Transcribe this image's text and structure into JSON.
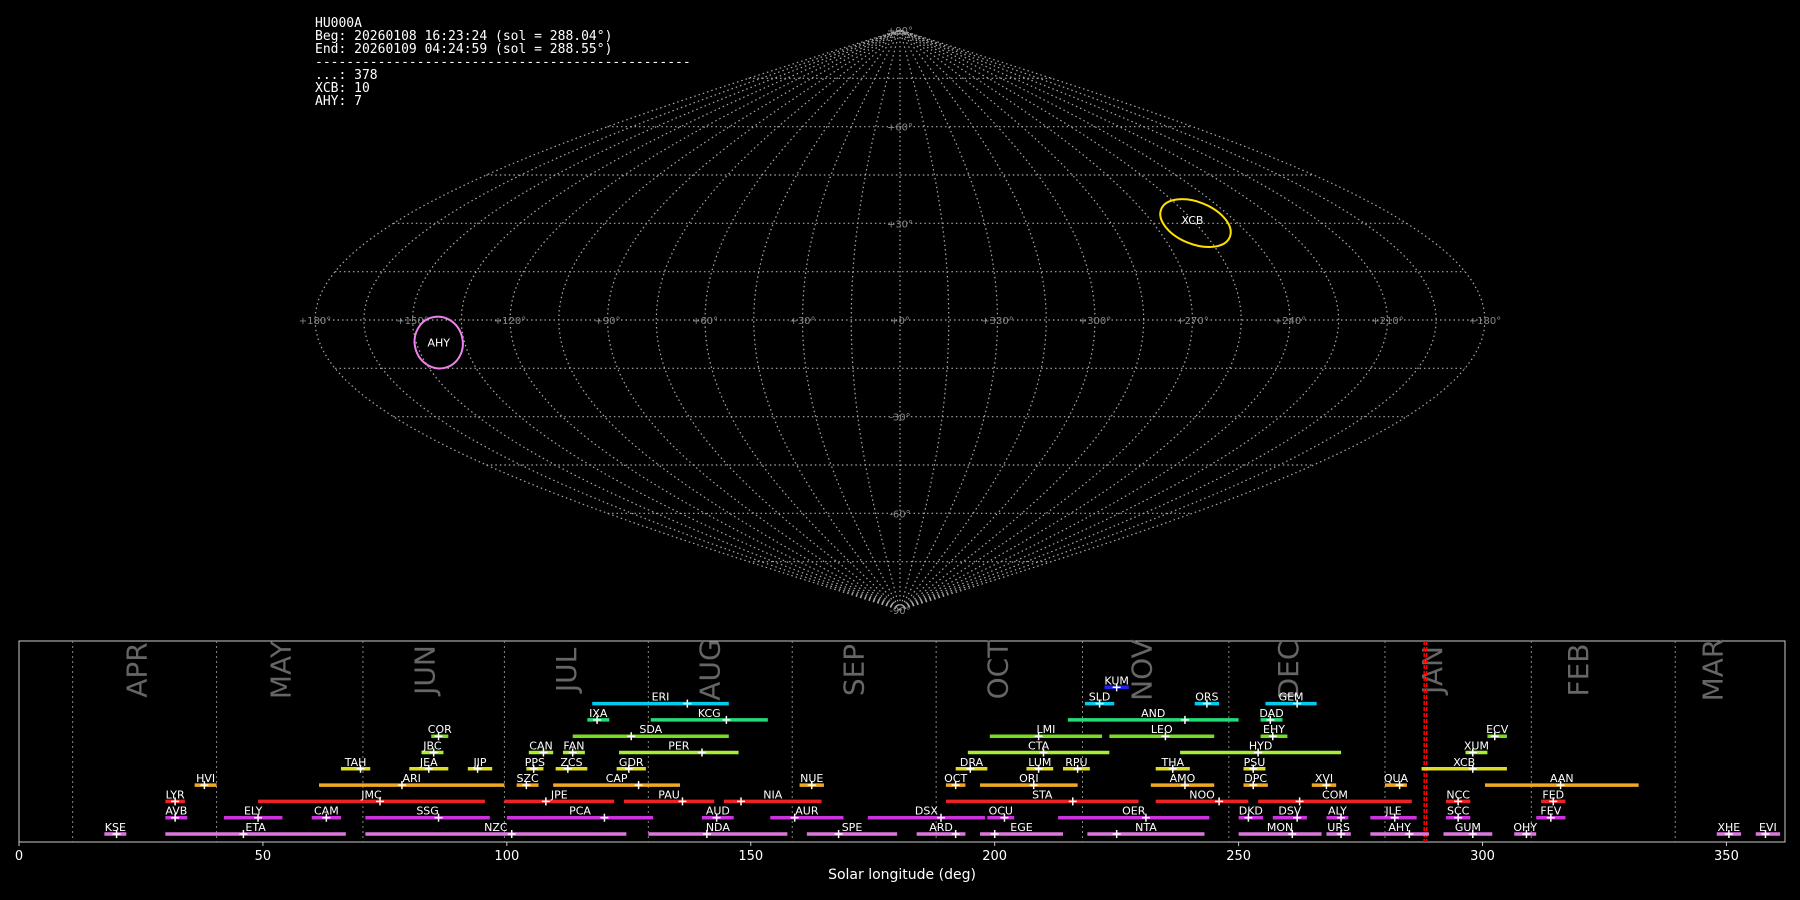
{
  "info": {
    "station": "HU000A",
    "beg": "Beg: 20260108 16:23:24 (sol = 288.04°)",
    "end": "End: 20260109 04:24:59 (sol = 288.55°)",
    "separator": "------------------------------------------------",
    "counts": [
      "...: 378",
      "XCB: 10",
      "AHY: 7"
    ]
  },
  "colors": {
    "background": "#000000",
    "grid": "#aaaaaa",
    "xcb_ellipse": "#ffe000",
    "ahy_ellipse": "#ee82ee",
    "current_sol_marker": "#ff0000"
  },
  "chart_data": [
    {
      "type": "scatter",
      "projection": "sinusoidal",
      "lon_ticks": [
        "+180°",
        "+150°",
        "+120°",
        "+90°",
        "+60°",
        "+30°",
        "+0°",
        "+330°",
        "+300°",
        "+270°",
        "+240°",
        "+210°",
        "+180°"
      ],
      "lat_ticks": [
        "+90°",
        "+60°",
        "+30°",
        "-30°",
        "-60°",
        "-90°"
      ],
      "lon_tick_values": [
        180,
        150,
        120,
        90,
        60,
        30,
        0,
        330,
        300,
        270,
        240,
        210,
        180
      ],
      "lat_tick_values": [
        90,
        60,
        30,
        -30,
        -60,
        -90
      ],
      "radiant_labels": [
        {
          "name": "XCB",
          "lon": 255,
          "lat": 31
        },
        {
          "name": "AHY",
          "lon": 143,
          "lat": -7
        }
      ],
      "grid": true
    },
    {
      "type": "bar",
      "xlabel": "Solar longitude (deg)",
      "xlim": [
        0,
        362
      ],
      "x_ticks": [
        0,
        50,
        100,
        150,
        200,
        250,
        300,
        350
      ],
      "month_labels": [
        "APR",
        "MAY",
        "JUN",
        "JUL",
        "AUG",
        "SEP",
        "OCT",
        "NOV",
        "DEC",
        "JAN",
        "FEB",
        "MAR"
      ],
      "month_label_positions": [
        24.5,
        54,
        83.5,
        112.5,
        142,
        171.5,
        201,
        230.5,
        260.5,
        290,
        320,
        347.5
      ],
      "month_boundaries": [
        11,
        40.5,
        70.5,
        99.5,
        129,
        158.5,
        188,
        218,
        248,
        280,
        310,
        339.5
      ],
      "current_sol": [
        288.04,
        288.55
      ],
      "showers": [
        {
          "name": "KUM",
          "start": 222.5,
          "end": 227.5,
          "peak": 225,
          "color": "#2222ee",
          "row": 10
        },
        {
          "name": "ERI",
          "start": 117.5,
          "end": 145.5,
          "peak": 137,
          "color": "#00ccee",
          "row": 9
        },
        {
          "name": "SLD",
          "start": 218.5,
          "end": 224.5,
          "peak": 221.5,
          "color": "#00ccee",
          "row": 9
        },
        {
          "name": "ORS",
          "start": 241,
          "end": 246,
          "peak": 243.5,
          "color": "#00ccee",
          "row": 9
        },
        {
          "name": "GEM",
          "start": 255.5,
          "end": 266,
          "peak": 262,
          "color": "#00ccee",
          "row": 9
        },
        {
          "name": "IXA",
          "start": 116.5,
          "end": 121,
          "peak": 118.5,
          "color": "#22dd77",
          "row": 8
        },
        {
          "name": "KCG",
          "start": 129.5,
          "end": 153.5,
          "peak": 145,
          "color": "#22dd77",
          "row": 8
        },
        {
          "name": "AND",
          "start": 215,
          "end": 250,
          "peak": 239,
          "color": "#22dd77",
          "row": 8
        },
        {
          "name": "DAD",
          "start": 254.5,
          "end": 259,
          "peak": 256.5,
          "color": "#22dd77",
          "row": 8
        },
        {
          "name": "COR",
          "start": 84.5,
          "end": 88,
          "peak": 86,
          "color": "#77dd22",
          "row": 7
        },
        {
          "name": "SDA",
          "start": 113.5,
          "end": 145.5,
          "peak": 125.5,
          "color": "#77dd22",
          "row": 7
        },
        {
          "name": "LMI",
          "start": 199,
          "end": 222,
          "peak": 209,
          "color": "#77dd22",
          "row": 7
        },
        {
          "name": "LEO",
          "start": 223.5,
          "end": 245,
          "peak": 235,
          "color": "#77dd22",
          "row": 7
        },
        {
          "name": "EHY",
          "start": 254.5,
          "end": 260,
          "peak": 257,
          "color": "#77dd22",
          "row": 7
        },
        {
          "name": "ECV",
          "start": 301,
          "end": 305,
          "peak": 302.5,
          "color": "#77dd22",
          "row": 7
        },
        {
          "name": "JBC",
          "start": 82.5,
          "end": 87,
          "peak": 85,
          "color": "#aaee33",
          "row": 6
        },
        {
          "name": "CAN",
          "start": 104.5,
          "end": 109.5,
          "peak": 107.5,
          "color": "#aaee33",
          "row": 6
        },
        {
          "name": "FAN",
          "start": 111.5,
          "end": 116,
          "peak": 113.5,
          "color": "#aaee33",
          "row": 6
        },
        {
          "name": "PER",
          "start": 123,
          "end": 147.5,
          "peak": 140,
          "color": "#aaee33",
          "row": 6
        },
        {
          "name": "CTA",
          "start": 194.5,
          "end": 223.5,
          "peak": 210,
          "color": "#aaee33",
          "row": 6
        },
        {
          "name": "HYD",
          "start": 238,
          "end": 271,
          "peak": 254,
          "color": "#aaee33",
          "row": 6
        },
        {
          "name": "XUM",
          "start": 296.5,
          "end": 301,
          "peak": 298,
          "color": "#aaee33",
          "row": 6
        },
        {
          "name": "TAH",
          "start": 66,
          "end": 72,
          "peak": 70,
          "color": "#dddd22",
          "row": 5
        },
        {
          "name": "JEA",
          "start": 80,
          "end": 88,
          "peak": 84,
          "color": "#dddd22",
          "row": 5
        },
        {
          "name": "JIP",
          "start": 92,
          "end": 97,
          "peak": 94,
          "color": "#dddd22",
          "row": 5
        },
        {
          "name": "PPS",
          "start": 104,
          "end": 107.5,
          "peak": 105.5,
          "color": "#dddd22",
          "row": 5
        },
        {
          "name": "ZCS",
          "start": 110,
          "end": 116.5,
          "peak": 112.5,
          "color": "#dddd22",
          "row": 5
        },
        {
          "name": "GDR",
          "start": 122.5,
          "end": 128.5,
          "peak": 125,
          "color": "#dddd22",
          "row": 5
        },
        {
          "name": "DRA",
          "start": 192,
          "end": 198.5,
          "peak": 195,
          "color": "#dddd22",
          "row": 5
        },
        {
          "name": "LUM",
          "start": 206.5,
          "end": 212,
          "peak": 209,
          "color": "#dddd22",
          "row": 5
        },
        {
          "name": "RPU",
          "start": 214,
          "end": 219.5,
          "peak": 217,
          "color": "#dddd22",
          "row": 5
        },
        {
          "name": "THA",
          "start": 233,
          "end": 240,
          "peak": 236.5,
          "color": "#dddd22",
          "row": 5
        },
        {
          "name": "PSU",
          "start": 251,
          "end": 255.5,
          "peak": 253,
          "color": "#dddd22",
          "row": 5
        },
        {
          "name": "XCB",
          "start": 287.5,
          "end": 305,
          "peak": 298,
          "color": "#dddd22",
          "row": 5
        },
        {
          "name": "HVI",
          "start": 36,
          "end": 40.5,
          "peak": 38,
          "color": "#eeaa22",
          "row": 4
        },
        {
          "name": "ARI",
          "start": 61.5,
          "end": 99.5,
          "peak": 78.5,
          "color": "#eeaa22",
          "row": 4
        },
        {
          "name": "SZC",
          "start": 102,
          "end": 106.5,
          "peak": 104,
          "color": "#eeaa22",
          "row": 4
        },
        {
          "name": "CAP",
          "start": 109.5,
          "end": 135.5,
          "peak": 127,
          "color": "#eeaa22",
          "row": 4
        },
        {
          "name": "NUE",
          "start": 160,
          "end": 165,
          "peak": 162.5,
          "color": "#eeaa22",
          "row": 4
        },
        {
          "name": "OCT",
          "start": 190,
          "end": 194,
          "peak": 192,
          "color": "#eeaa22",
          "row": 4
        },
        {
          "name": "ORI",
          "start": 197,
          "end": 217,
          "peak": 208,
          "color": "#eeaa22",
          "row": 4
        },
        {
          "name": "AMO",
          "start": 232,
          "end": 245,
          "peak": 239,
          "color": "#eeaa22",
          "row": 4
        },
        {
          "name": "DPC",
          "start": 251,
          "end": 256,
          "peak": 253,
          "color": "#eeaa22",
          "row": 4
        },
        {
          "name": "XVI",
          "start": 265,
          "end": 270,
          "peak": 268,
          "color": "#eeaa22",
          "row": 4
        },
        {
          "name": "QUA",
          "start": 280,
          "end": 284.5,
          "peak": 283,
          "color": "#eeaa22",
          "row": 4
        },
        {
          "name": "AAN",
          "start": 300.5,
          "end": 332,
          "peak": 316,
          "color": "#eeaa22",
          "row": 4
        },
        {
          "name": "LYR",
          "start": 30,
          "end": 34,
          "peak": 32,
          "color": "#ee2222",
          "row": 3
        },
        {
          "name": "JMC",
          "start": 49,
          "end": 95.5,
          "peak": 74,
          "color": "#ee2222",
          "row": 3
        },
        {
          "name": "JPE",
          "start": 99.5,
          "end": 122,
          "peak": 108,
          "color": "#ee2222",
          "row": 3
        },
        {
          "name": "PAU",
          "start": 124,
          "end": 142.5,
          "peak": 136,
          "color": "#ee2222",
          "row": 3
        },
        {
          "name": "NIA",
          "start": 144.5,
          "end": 164.5,
          "peak": 148,
          "color": "#ee2222",
          "row": 3
        },
        {
          "name": "STA",
          "start": 190,
          "end": 229.5,
          "peak": 216,
          "color": "#ee2222",
          "row": 3
        },
        {
          "name": "NOO",
          "start": 233,
          "end": 252,
          "peak": 246,
          "color": "#ee2222",
          "row": 3
        },
        {
          "name": "COM",
          "start": 254,
          "end": 285.5,
          "peak": 262.5,
          "color": "#ee2222",
          "row": 3
        },
        {
          "name": "NCC",
          "start": 292.5,
          "end": 297.5,
          "peak": 295,
          "color": "#ee2222",
          "row": 3
        },
        {
          "name": "FED",
          "start": 312,
          "end": 317,
          "peak": 314.5,
          "color": "#ee2222",
          "row": 3
        },
        {
          "name": "AVB",
          "start": 30,
          "end": 34.5,
          "peak": 32,
          "color": "#cc33dd",
          "row": 2
        },
        {
          "name": "ELY",
          "start": 42,
          "end": 54,
          "peak": 49,
          "color": "#cc33dd",
          "row": 2
        },
        {
          "name": "CAM",
          "start": 60,
          "end": 66,
          "peak": 63,
          "color": "#cc33dd",
          "row": 2
        },
        {
          "name": "SSG",
          "start": 71,
          "end": 96.5,
          "peak": 86,
          "color": "#cc33dd",
          "row": 2
        },
        {
          "name": "PCA",
          "start": 100,
          "end": 130,
          "peak": 120,
          "color": "#cc33dd",
          "row": 2
        },
        {
          "name": "AUD",
          "start": 140,
          "end": 146.5,
          "peak": 143,
          "color": "#cc33dd",
          "row": 2
        },
        {
          "name": "AUR",
          "start": 154,
          "end": 169,
          "peak": 159,
          "color": "#cc33dd",
          "row": 2
        },
        {
          "name": "DSX",
          "start": 174,
          "end": 198,
          "peak": 189,
          "color": "#cc33dd",
          "row": 2
        },
        {
          "name": "OCU",
          "start": 198.5,
          "end": 204,
          "peak": 202,
          "color": "#cc33dd",
          "row": 2
        },
        {
          "name": "OER",
          "start": 213,
          "end": 244,
          "peak": 231,
          "color": "#cc33dd",
          "row": 2
        },
        {
          "name": "DKD",
          "start": 250,
          "end": 255,
          "peak": 252,
          "color": "#cc33dd",
          "row": 2
        },
        {
          "name": "DSV",
          "start": 257,
          "end": 264,
          "peak": 262,
          "color": "#cc33dd",
          "row": 2
        },
        {
          "name": "ALY",
          "start": 268,
          "end": 272.5,
          "peak": 271,
          "color": "#cc33dd",
          "row": 2
        },
        {
          "name": "JLE",
          "start": 277,
          "end": 286.5,
          "peak": 282,
          "color": "#cc33dd",
          "row": 2
        },
        {
          "name": "SCC",
          "start": 292.5,
          "end": 297.5,
          "peak": 295,
          "color": "#cc33dd",
          "row": 2
        },
        {
          "name": "FEV",
          "start": 311,
          "end": 317,
          "peak": 314,
          "color": "#cc33dd",
          "row": 2
        },
        {
          "name": "KSE",
          "start": 17.5,
          "end": 22,
          "peak": 20,
          "color": "#dd77dd",
          "row": 1
        },
        {
          "name": "ETA",
          "start": 30,
          "end": 67,
          "peak": 46,
          "color": "#dd77dd",
          "row": 1
        },
        {
          "name": "NZC",
          "start": 71,
          "end": 124.5,
          "peak": 101,
          "color": "#dd77dd",
          "row": 1
        },
        {
          "name": "NDA",
          "start": 129,
          "end": 157.5,
          "peak": 141,
          "color": "#dd77dd",
          "row": 1
        },
        {
          "name": "SPE",
          "start": 161.5,
          "end": 180,
          "peak": 168,
          "color": "#dd77dd",
          "row": 1
        },
        {
          "name": "ARD",
          "start": 184,
          "end": 194,
          "peak": 192,
          "color": "#dd77dd",
          "row": 1
        },
        {
          "name": "EGE",
          "start": 197,
          "end": 214,
          "peak": 200,
          "color": "#dd77dd",
          "row": 1
        },
        {
          "name": "NTA",
          "start": 219,
          "end": 243,
          "peak": 225,
          "color": "#dd77dd",
          "row": 1
        },
        {
          "name": "MON",
          "start": 250,
          "end": 267,
          "peak": 261,
          "color": "#dd77dd",
          "row": 1
        },
        {
          "name": "URS",
          "start": 268,
          "end": 273,
          "peak": 271,
          "color": "#dd77dd",
          "row": 1
        },
        {
          "name": "AHY",
          "start": 277,
          "end": 289,
          "peak": 285,
          "color": "#dd77dd",
          "row": 1
        },
        {
          "name": "GUM",
          "start": 292,
          "end": 302,
          "peak": 298,
          "color": "#dd77dd",
          "row": 1
        },
        {
          "name": "OHY",
          "start": 306.5,
          "end": 311,
          "peak": 309,
          "color": "#dd77dd",
          "row": 1
        },
        {
          "name": "XHE",
          "start": 348,
          "end": 353,
          "peak": 350.5,
          "color": "#dd77dd",
          "row": 1
        },
        {
          "name": "EVI",
          "start": 356,
          "end": 361,
          "peak": 358,
          "color": "#dd77dd",
          "row": 1
        }
      ]
    }
  ]
}
